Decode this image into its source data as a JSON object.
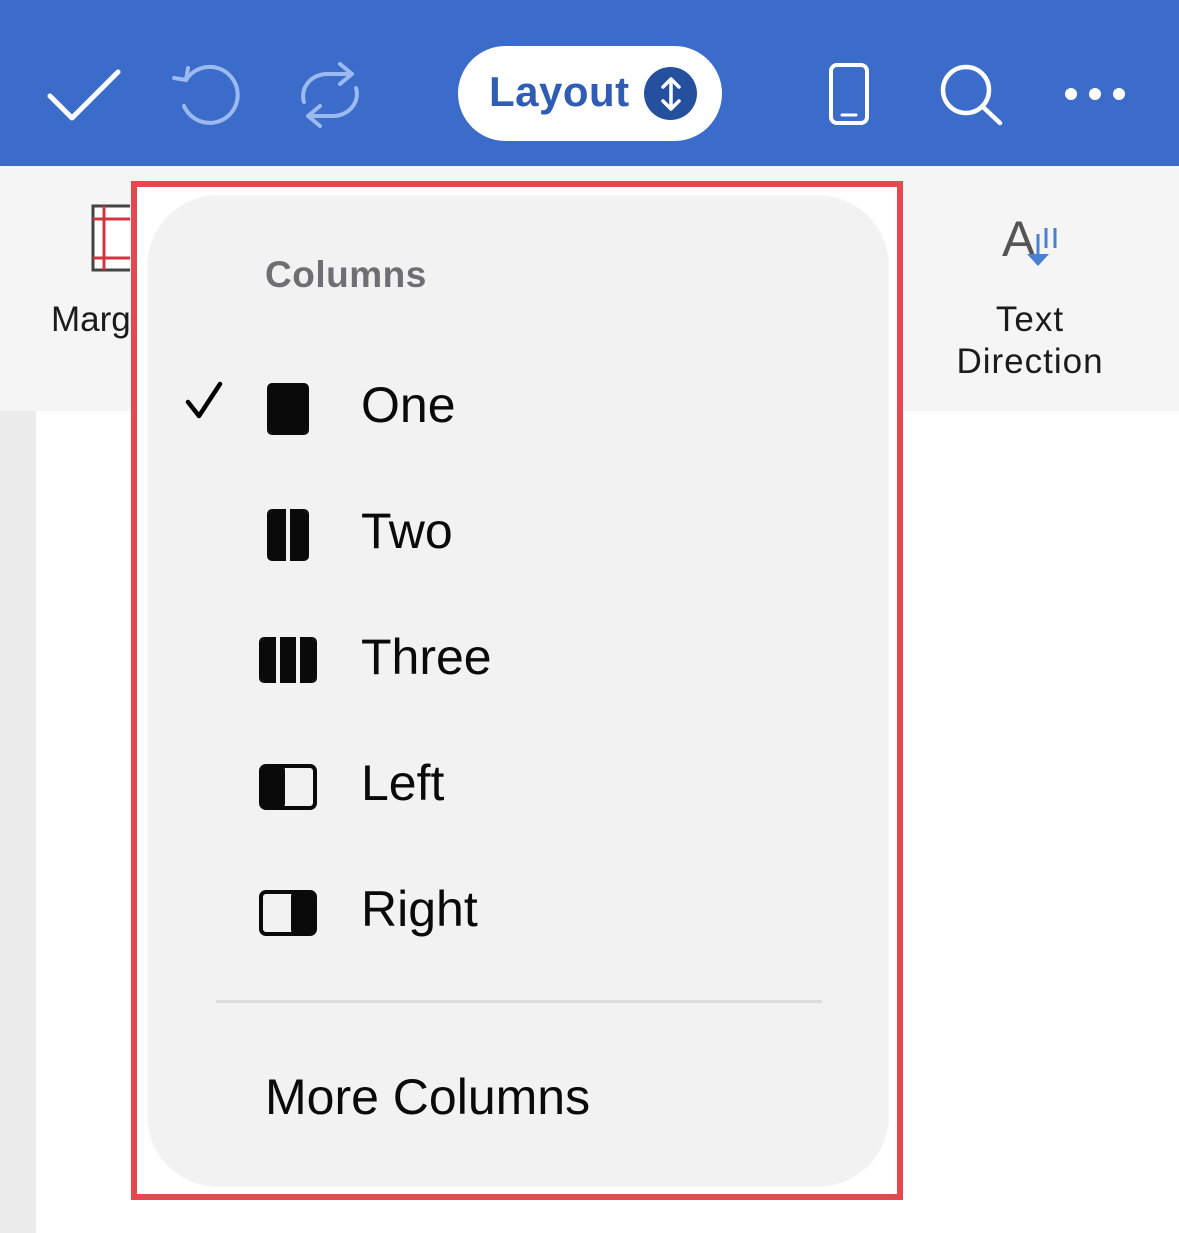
{
  "toolbar": {
    "done_icon": "checkmark-icon",
    "undo_icon": "undo-icon",
    "redo_icon": "redo-icon",
    "tab_label": "Layout",
    "tab_toggle_icon": "switch-ribbon-icon",
    "mobile_view_icon": "phone-icon",
    "search_icon": "search-icon",
    "more_icon": "more-icon",
    "bar_color": "#3b6cc9"
  },
  "ribbon": {
    "margins_label": "Marg",
    "text_direction_line1": "Text",
    "text_direction_line2": "Direction"
  },
  "columns_menu": {
    "title": "Columns",
    "options": [
      {
        "label": "One",
        "icon": "one-column-icon",
        "selected": true
      },
      {
        "label": "Two",
        "icon": "two-columns-icon",
        "selected": false
      },
      {
        "label": "Three",
        "icon": "three-columns-icon",
        "selected": false
      },
      {
        "label": "Left",
        "icon": "left-column-icon",
        "selected": false
      },
      {
        "label": "Right",
        "icon": "right-column-icon",
        "selected": false
      }
    ],
    "more_label": "More Columns",
    "highlight_color": "#e5484d"
  }
}
